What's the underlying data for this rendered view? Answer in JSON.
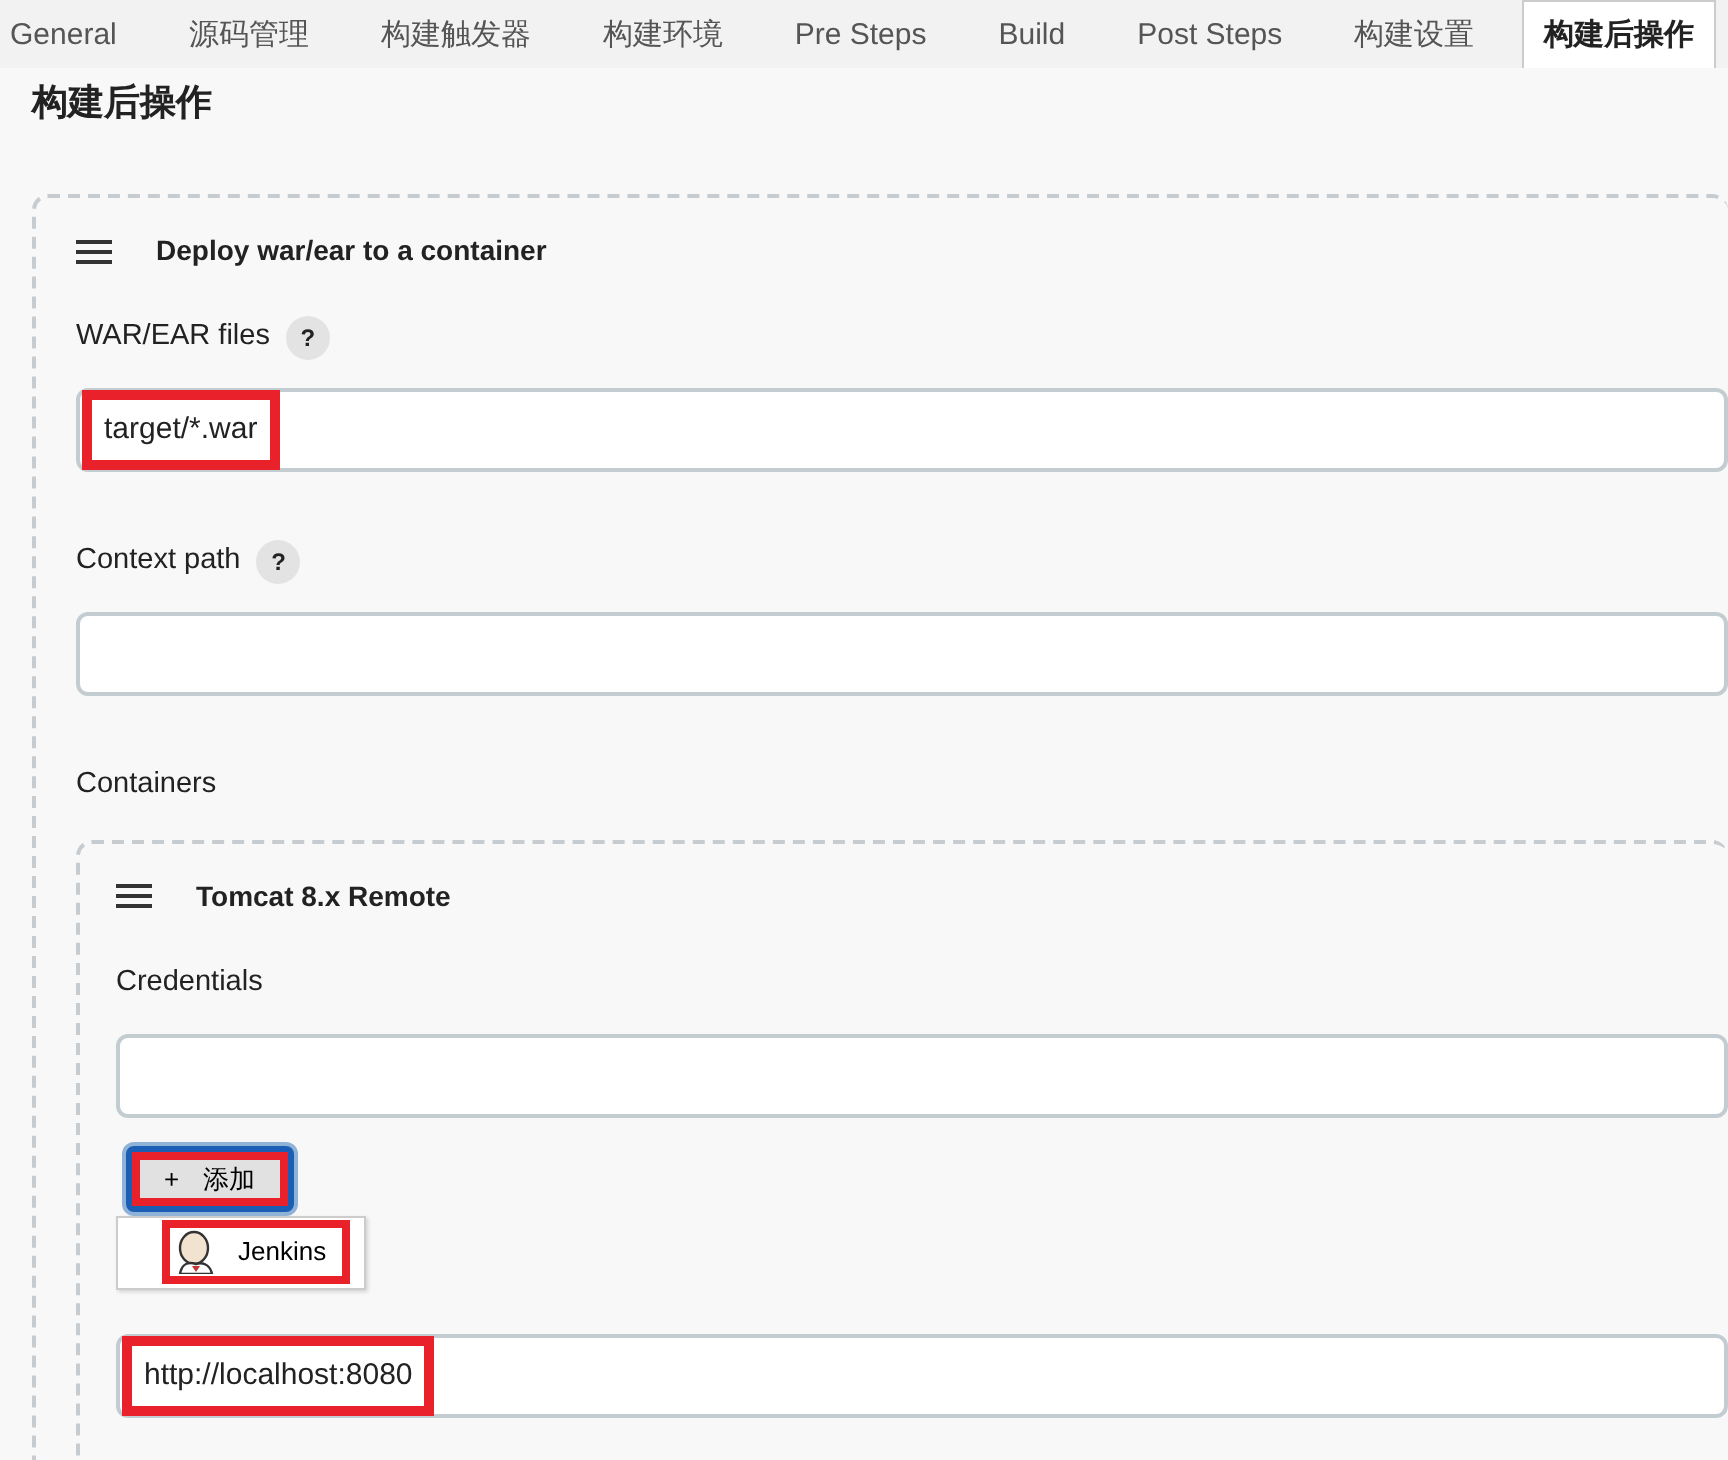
{
  "tabs": [
    {
      "label": "General",
      "selected": false
    },
    {
      "label": "源码管理",
      "selected": false
    },
    {
      "label": "构建触发器",
      "selected": false
    },
    {
      "label": "构建环境",
      "selected": false
    },
    {
      "label": "Pre Steps",
      "selected": false
    },
    {
      "label": "Build",
      "selected": false
    },
    {
      "label": "Post Steps",
      "selected": false
    },
    {
      "label": "构建设置",
      "selected": false
    },
    {
      "label": "构建后操作",
      "selected": true
    }
  ],
  "section_title": "构建后操作",
  "step": {
    "title": "Deploy war/ear to a container",
    "fields": [
      {
        "label": "WAR/EAR files",
        "help": "?",
        "value": "target/*.war",
        "highlighted": true
      },
      {
        "label": "Context path",
        "help": "?"
      }
    ],
    "containers_label": "Containers",
    "container": {
      "title": "Tomcat 8.x Remote",
      "credentials_label": "Credentials",
      "add_button": {
        "icon": "+",
        "label": "添加",
        "highlighted": true
      },
      "add_menu": [
        {
          "label": "Jenkins",
          "highlighted": true
        }
      ],
      "url_field": {
        "value": "http://localhost:8080",
        "highlighted": true
      }
    }
  }
}
